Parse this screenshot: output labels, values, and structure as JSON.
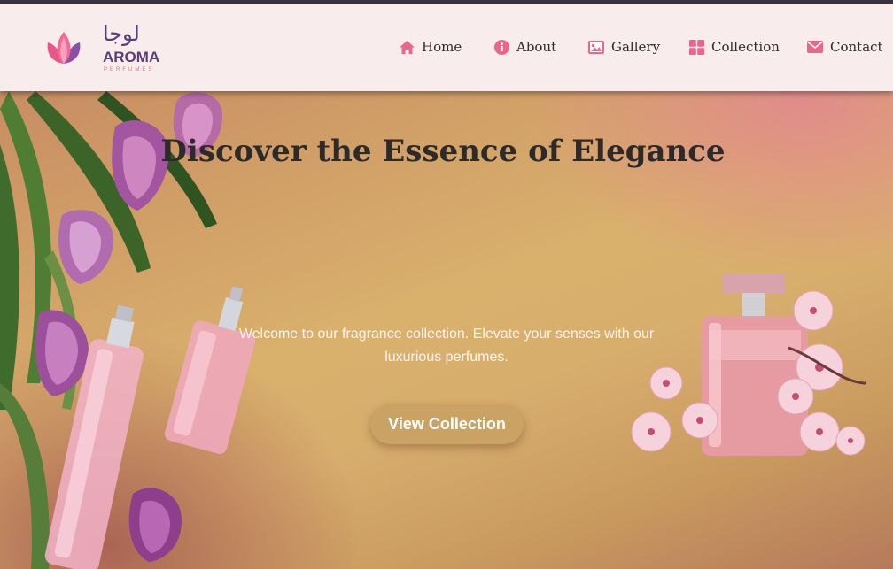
{
  "brand": {
    "arabic_mark": "لوجا",
    "name": "AROMA",
    "tagline": "PERFUMES"
  },
  "nav": [
    {
      "label": "Home",
      "icon": "home-icon"
    },
    {
      "label": "About",
      "icon": "info-icon"
    },
    {
      "label": "Gallery",
      "icon": "image-icon"
    },
    {
      "label": "Collection",
      "icon": "grid-icon"
    },
    {
      "label": "Contact",
      "icon": "envelope-icon"
    }
  ],
  "hero": {
    "title": "Discover the Essence of Elegance",
    "intro": "Welcome to our fragrance collection. Elevate your senses with our luxurious perfumes.",
    "cta_label": "View Collection"
  },
  "colors": {
    "nav_background": "#f9eced",
    "nav_icon": "#e9678c",
    "brand_purple": "#5b3d7a",
    "cta_background": "#caa263",
    "title_text": "#2d2a2a"
  }
}
